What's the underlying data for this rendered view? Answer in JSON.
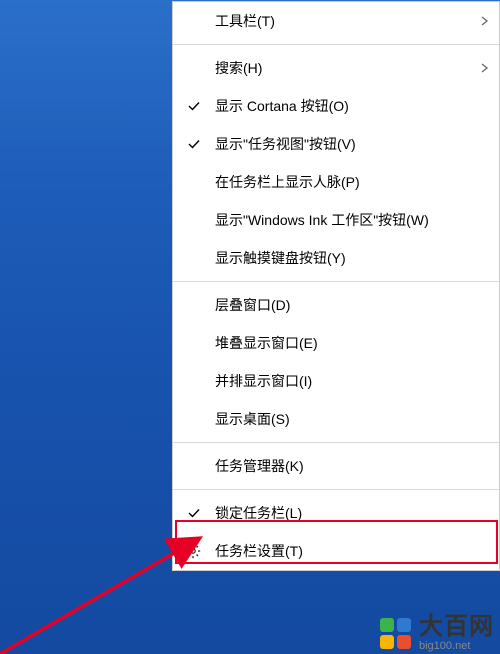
{
  "menu": {
    "items": [
      {
        "label": "工具栏(T)",
        "checked": false,
        "submenu": true
      },
      {
        "type": "sep"
      },
      {
        "label": "搜索(H)",
        "checked": false,
        "submenu": true
      },
      {
        "label": "显示 Cortana 按钮(O)",
        "checked": true,
        "submenu": false
      },
      {
        "label": "显示\"任务视图\"按钮(V)",
        "checked": true,
        "submenu": false
      },
      {
        "label": "在任务栏上显示人脉(P)",
        "checked": false,
        "submenu": false
      },
      {
        "label": "显示\"Windows Ink 工作区\"按钮(W)",
        "checked": false,
        "submenu": false
      },
      {
        "label": "显示触摸键盘按钮(Y)",
        "checked": false,
        "submenu": false
      },
      {
        "type": "sep"
      },
      {
        "label": "层叠窗口(D)",
        "checked": false,
        "submenu": false
      },
      {
        "label": "堆叠显示窗口(E)",
        "checked": false,
        "submenu": false
      },
      {
        "label": "并排显示窗口(I)",
        "checked": false,
        "submenu": false
      },
      {
        "label": "显示桌面(S)",
        "checked": false,
        "submenu": false
      },
      {
        "type": "sep"
      },
      {
        "label": "任务管理器(K)",
        "checked": false,
        "submenu": false
      },
      {
        "type": "sep"
      },
      {
        "label": "锁定任务栏(L)",
        "checked": true,
        "submenu": false
      },
      {
        "label": "任务栏设置(T)",
        "checked": false,
        "submenu": false,
        "icon": "gear"
      }
    ]
  },
  "highlight": {
    "target_label": "锁定任务栏(L)",
    "color": "#e60026"
  },
  "watermark": {
    "cn": "大百网",
    "en": "big100.net",
    "logo_colors": [
      "#3bb44a",
      "#2f7ad0",
      "#f7b500",
      "#e94f2e"
    ]
  }
}
